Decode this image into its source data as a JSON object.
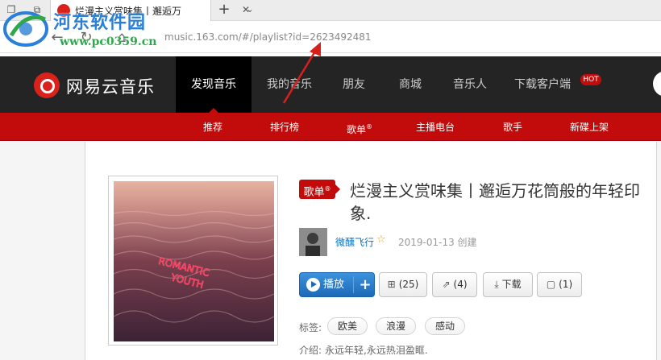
{
  "browser": {
    "tab_title": "烂漫主义赏味集丨邂逅万",
    "url": "music.163.com/#/playlist?id=2623492481"
  },
  "watermark": {
    "site_name": "河东软件园",
    "site_url": "www.pc0359.cn"
  },
  "header": {
    "logo_text": "网易云音乐",
    "nav": [
      {
        "label": "发现音乐",
        "active": true
      },
      {
        "label": "我的音乐"
      },
      {
        "label": "朋友"
      },
      {
        "label": "商城"
      },
      {
        "label": "音乐人"
      },
      {
        "label": "下载客户端"
      }
    ],
    "hot_badge": "HOT"
  },
  "subnav": [
    "推荐",
    "排行榜",
    "歌单",
    "主播电台",
    "歌手",
    "新碟上架"
  ],
  "subnav_sup": "®",
  "playlist": {
    "badge": "歌单",
    "badge_sup": "®",
    "title": "烂漫主义赏味集丨邂逅万花筒般的年轻印象.",
    "creator": "微醺飞行",
    "created": "2019-01-13 创建",
    "cover_text_1": "ROMANTIC",
    "cover_text_2": "YOUTH",
    "buttons": {
      "play": "播放",
      "collect": "(25)",
      "share": "(4)",
      "download": "下载",
      "comment": "(1)"
    },
    "tags_label": "标签:",
    "tags": [
      "欧美",
      "浪漫",
      "感动"
    ],
    "intro_label": "介绍:",
    "intro": "永远年轻,永远热泪盈眶."
  },
  "colors": {
    "brand_red": "#c20c0c",
    "header_bg": "#242424",
    "play_blue": "#1d6ab7",
    "link_blue": "#0c73c2"
  }
}
